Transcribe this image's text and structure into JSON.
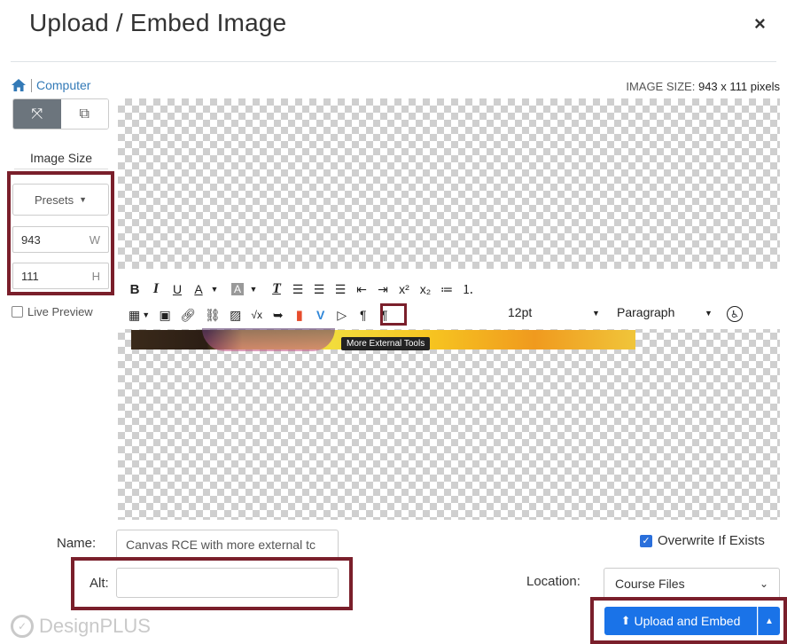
{
  "modal": {
    "title": "Upload / Embed Image",
    "close_label": "×"
  },
  "breadcrumb": {
    "home_icon": "home-icon",
    "source": "Computer"
  },
  "image_size": {
    "label": "IMAGE SIZE:",
    "value": "943 x 111 pixels"
  },
  "sidebar": {
    "mode_buttons": [
      {
        "icon": "resize-icon",
        "symbol": "⤧",
        "active": true
      },
      {
        "icon": "crop-icon",
        "symbol": "⧉",
        "active": false
      }
    ],
    "size_label": "Image Size",
    "presets_label": "Presets",
    "width": {
      "value": "943",
      "unit": "W"
    },
    "height": {
      "value": "111",
      "unit": "H"
    },
    "live_preview_label": "Live Preview"
  },
  "editor_toolbar": {
    "font_size": "12pt",
    "block_format": "Paragraph",
    "tooltip": "More External Tools"
  },
  "form": {
    "name_label": "Name:",
    "name_value": "Canvas RCE with more external tc",
    "alt_label": "Alt:",
    "alt_value": "",
    "overwrite_label": "Overwrite If Exists",
    "overwrite_checked": true,
    "location_label": "Location:",
    "location_value": "Course Files"
  },
  "actions": {
    "upload_label": "Upload and Embed"
  },
  "branding": {
    "logo_text": "DesignPLUS"
  },
  "colors": {
    "accent": "#1a73e8",
    "highlight_box": "#7a1f2b",
    "link": "#337ab7"
  }
}
